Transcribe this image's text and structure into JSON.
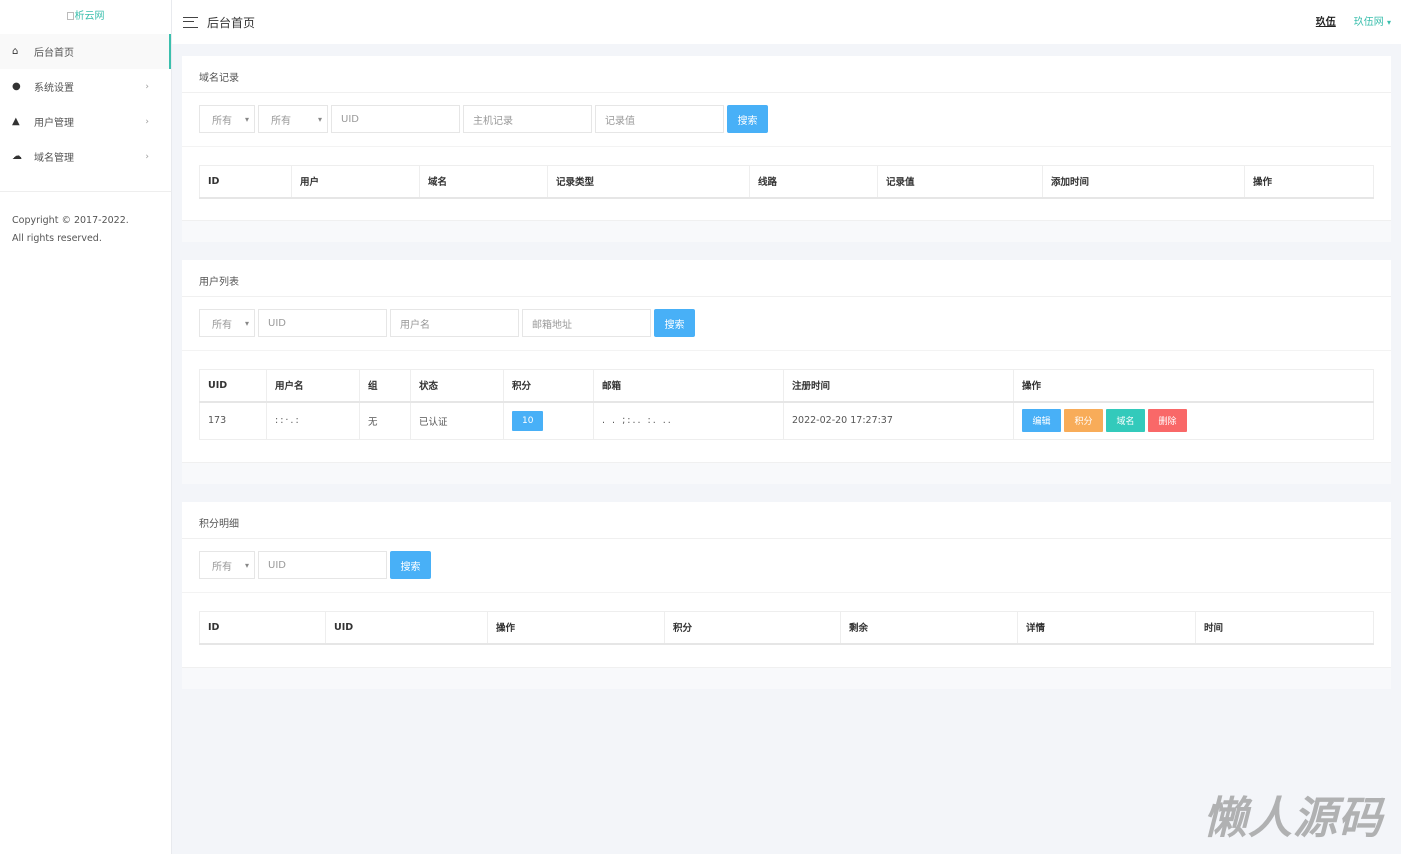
{
  "logo_alt": "析云网",
  "sidebar": {
    "items": [
      {
        "label": "后台首页",
        "icon": "home-icon",
        "glyph": "⌂"
      },
      {
        "label": "系统设置",
        "icon": "palette-icon",
        "glyph": "●"
      },
      {
        "label": "用户管理",
        "icon": "user-icon",
        "glyph": "▲"
      },
      {
        "label": "域名管理",
        "icon": "cloud-icon",
        "glyph": "☁"
      }
    ],
    "chevron": "›",
    "copyright": "Copyright © 2017-2022.",
    "rights": "All rights reserved."
  },
  "header": {
    "title": "后台首页",
    "user": "玖伍",
    "site": "玖伍网",
    "caret": "▾"
  },
  "domain_card": {
    "title": "域名记录",
    "filters": {
      "select1": "所有",
      "select2": "所有",
      "uid": "UID",
      "host": "主机记录",
      "value": "记录值"
    },
    "search": "搜索",
    "columns": [
      "ID",
      "用户",
      "域名",
      "记录类型",
      "线路",
      "记录值",
      "添加时间",
      "操作"
    ]
  },
  "user_card": {
    "title": "用户列表",
    "filters": {
      "select1": "所有",
      "uid": "UID",
      "username": "用户名",
      "email": "邮箱地址"
    },
    "search": "搜索",
    "columns": [
      "UID",
      "用户名",
      "组",
      "状态",
      "积分",
      "邮箱",
      "注册时间",
      "操作"
    ],
    "rows": [
      {
        "uid": "173",
        "username": "::·.:",
        "group": "无",
        "status": "已认证",
        "points": "10",
        "email": ".  . ;:..  :.  ..",
        "registered": "2022-02-20 17:27:37",
        "actions": [
          {
            "label": "编辑",
            "color": "#48b0f7"
          },
          {
            "label": "积分",
            "color": "#f8ac59"
          },
          {
            "label": "域名",
            "color": "#33cabb"
          },
          {
            "label": "删除",
            "color": "#f96868"
          }
        ]
      }
    ]
  },
  "points_card": {
    "title": "积分明细",
    "filters": {
      "select1": "所有",
      "uid": "UID"
    },
    "search": "搜索",
    "columns": [
      "ID",
      "UID",
      "操作",
      "积分",
      "剩余",
      "详情",
      "时间"
    ]
  },
  "watermark": "懒人源码"
}
